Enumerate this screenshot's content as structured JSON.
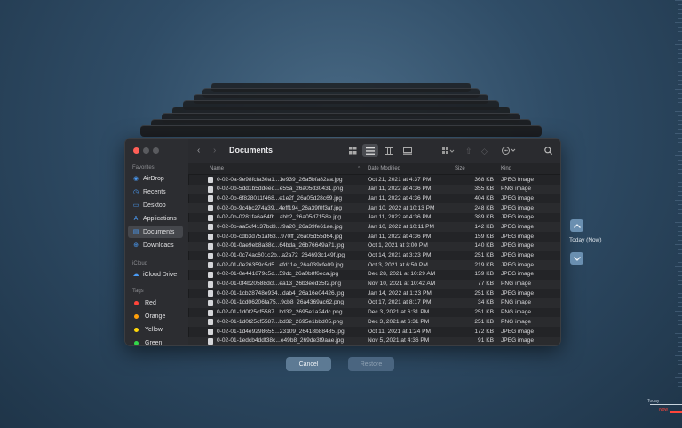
{
  "window": {
    "title": "Documents"
  },
  "sidebar": {
    "favorites_header": "Favorites",
    "favorites": [
      {
        "label": "AirDrop",
        "icon": "airdrop-icon"
      },
      {
        "label": "Recents",
        "icon": "clock-icon"
      },
      {
        "label": "Desktop",
        "icon": "desktop-icon"
      },
      {
        "label": "Applications",
        "icon": "applications-icon"
      },
      {
        "label": "Documents",
        "icon": "document-icon",
        "active": true
      },
      {
        "label": "Downloads",
        "icon": "download-icon"
      }
    ],
    "icloud_header": "iCloud",
    "icloud": [
      {
        "label": "iCloud Drive",
        "icon": "cloud-icon"
      }
    ],
    "tags_header": "Tags",
    "tags": [
      {
        "label": "Red",
        "color": "#ff453a"
      },
      {
        "label": "Orange",
        "color": "#ff9f0a"
      },
      {
        "label": "Yellow",
        "color": "#ffd60a"
      },
      {
        "label": "Green",
        "color": "#32d74b"
      }
    ]
  },
  "columns": {
    "name": "Name",
    "date": "Date Modified",
    "size": "Size",
    "kind": "Kind"
  },
  "files": [
    {
      "name": "0-02-0a-9e98fcfa30a1...1e939_26a5bfa82aa.jpg",
      "date": "Oct 21, 2021 at 4:37 PM",
      "size": "368 KB",
      "kind": "JPEG image"
    },
    {
      "name": "0-02-0b-5dd1b5ddeed...e55a_26a05d30431.png",
      "date": "Jan 11, 2022 at 4:36 PM",
      "size": "355 KB",
      "kind": "PNG image"
    },
    {
      "name": "0-02-0b-6f828011f468...e1e2f_26a05d28c69.jpg",
      "date": "Jan 11, 2022 at 4:36 PM",
      "size": "404 KB",
      "kind": "JPEG image"
    },
    {
      "name": "0-02-0b-9c4bc274a39...4eff194_26a39f0f3af.jpg",
      "date": "Jan 10, 2022 at 10:13 PM",
      "size": "248 KB",
      "kind": "JPEG image"
    },
    {
      "name": "0-02-0b-0281fa6a64fb...abb2_26a05d7158e.jpg",
      "date": "Jan 11, 2022 at 4:36 PM",
      "size": "389 KB",
      "kind": "JPEG image"
    },
    {
      "name": "0-02-0b-aa5cf4137bd3...f9a20_26a39fe61ae.jpg",
      "date": "Jan 10, 2022 at 10:11 PM",
      "size": "142 KB",
      "kind": "JPEG image"
    },
    {
      "name": "0-02-0b-cdb3d751af63...970ff_26a05d55d64.jpg",
      "date": "Jan 11, 2022 at 4:36 PM",
      "size": "159 KB",
      "kind": "JPEG image"
    },
    {
      "name": "0-02-01-0ae9eb8a38c...64bda_26b76649a71.jpg",
      "date": "Oct 1, 2021 at 3:00 PM",
      "size": "140 KB",
      "kind": "JPEG image"
    },
    {
      "name": "0-02-01-0c74ac601c2b...a2a72_264693c149f.jpg",
      "date": "Oct 14, 2021 at 3:23 PM",
      "size": "251 KB",
      "kind": "JPEG image"
    },
    {
      "name": "0-02-01-0e26359c5d5...efd11e_26a039cfe09.jpg",
      "date": "Oct 3, 2021 at 6:50 PM",
      "size": "219 KB",
      "kind": "JPEG image"
    },
    {
      "name": "0-02-01-0e441879c5d...59dc_26a0b8f6eca.jpg",
      "date": "Dec 28, 2021 at 10:29 AM",
      "size": "159 KB",
      "kind": "JPEG image"
    },
    {
      "name": "0-02-01-0f4b20588dcf...ea13_26b3eed35f2.png",
      "date": "Nov 10, 2021 at 10:42 AM",
      "size": "77 KB",
      "kind": "PNG image"
    },
    {
      "name": "0-02-01-1cb28748e934...dab4_26a16e04426.jpg",
      "date": "Jan 14, 2022 at 1:23 PM",
      "size": "251 KB",
      "kind": "JPEG image"
    },
    {
      "name": "0-02-01-1cd06206fa75...9cb8_26a4369ac62.png",
      "date": "Oct 17, 2021 at 8:17 PM",
      "size": "34 KB",
      "kind": "PNG image"
    },
    {
      "name": "0-02-01-1d0f25cf5587...bd32_2695e1a24dc.png",
      "date": "Dec 3, 2021 at 6:31 PM",
      "size": "251 KB",
      "kind": "PNG image"
    },
    {
      "name": "0-02-01-1d0f25cf5587...bd32_2695e1bbd05.png",
      "date": "Dec 3, 2021 at 6:31 PM",
      "size": "251 KB",
      "kind": "PNG image"
    },
    {
      "name": "0-02-01-1d4e9298655...23109_26418b88485.jpg",
      "date": "Oct 11, 2021 at 1:24 PM",
      "size": "172 KB",
      "kind": "JPEG image"
    },
    {
      "name": "0-02-01-1edcb4ddf38c...e49b8_269de3f9aae.jpg",
      "date": "Nov 5, 2021 at 4:36 PM",
      "size": "91 KB",
      "kind": "JPEG image"
    }
  ],
  "buttons": {
    "cancel": "Cancel",
    "restore": "Restore"
  },
  "timeline": {
    "current": "Today (Now)",
    "today": "Today",
    "now": "Now"
  },
  "colors": {
    "accent": "#4a9bf5",
    "now_marker": "#ff453a"
  }
}
